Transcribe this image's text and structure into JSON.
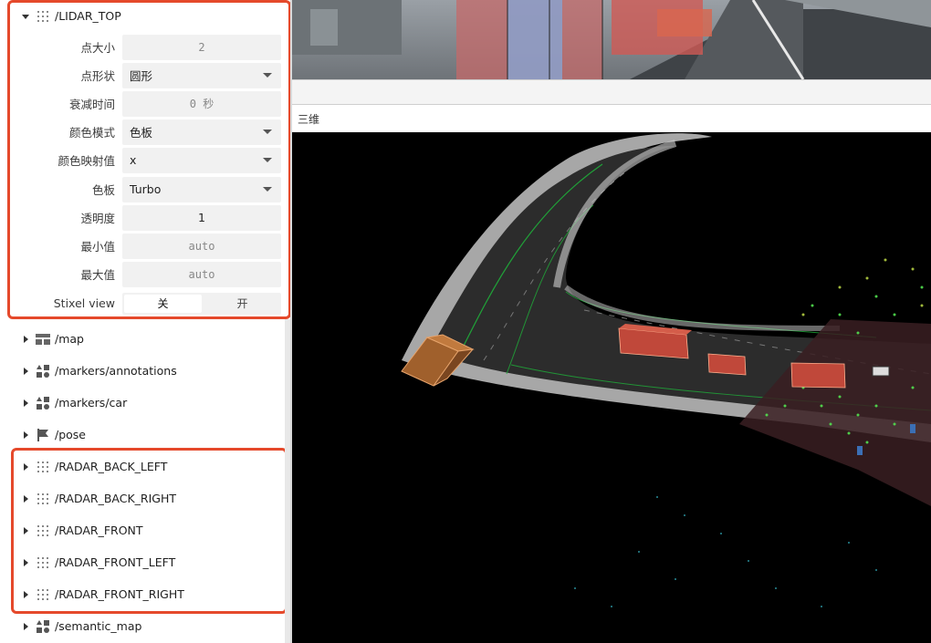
{
  "lidar": {
    "topic": "/LIDAR_TOP",
    "settings": {
      "point_size": {
        "label": "点大小",
        "value": "2"
      },
      "point_shape": {
        "label": "点形状",
        "value": "圆形"
      },
      "decay_time": {
        "label": "衰减时间",
        "value": "0 秒"
      },
      "color_mode": {
        "label": "颜色模式",
        "value": "色板"
      },
      "color_by": {
        "label": "颜色映射值",
        "value": "x"
      },
      "colormap": {
        "label": "色板",
        "value": "Turbo"
      },
      "opacity": {
        "label": "透明度",
        "value": "1"
      },
      "min_value": {
        "label": "最小值",
        "value": "auto"
      },
      "max_value": {
        "label": "最大值",
        "value": "auto"
      },
      "stixel": {
        "label": "Stixel view",
        "off": "关",
        "on": "开",
        "selected": "off"
      }
    }
  },
  "topics": [
    {
      "name": "/map",
      "icon": "map-grid-icon"
    },
    {
      "name": "/markers/annotations",
      "icon": "shapes-icon"
    },
    {
      "name": "/markers/car",
      "icon": "shapes-icon"
    },
    {
      "name": "/pose",
      "icon": "flag-icon"
    },
    {
      "name": "/RADAR_BACK_LEFT",
      "icon": "point-cloud-icon"
    },
    {
      "name": "/RADAR_BACK_RIGHT",
      "icon": "point-cloud-icon"
    },
    {
      "name": "/RADAR_FRONT",
      "icon": "point-cloud-icon"
    },
    {
      "name": "/RADAR_FRONT_LEFT",
      "icon": "point-cloud-icon"
    },
    {
      "name": "/RADAR_FRONT_RIGHT",
      "icon": "point-cloud-icon"
    },
    {
      "name": "/semantic_map",
      "icon": "shapes-icon"
    }
  ],
  "panel3d": {
    "title": "三维"
  },
  "colors": {
    "highlight": "#e5492b",
    "view_bg": "#000000",
    "box_fill": "#c0483a",
    "cube_fill": "#a0602c"
  }
}
